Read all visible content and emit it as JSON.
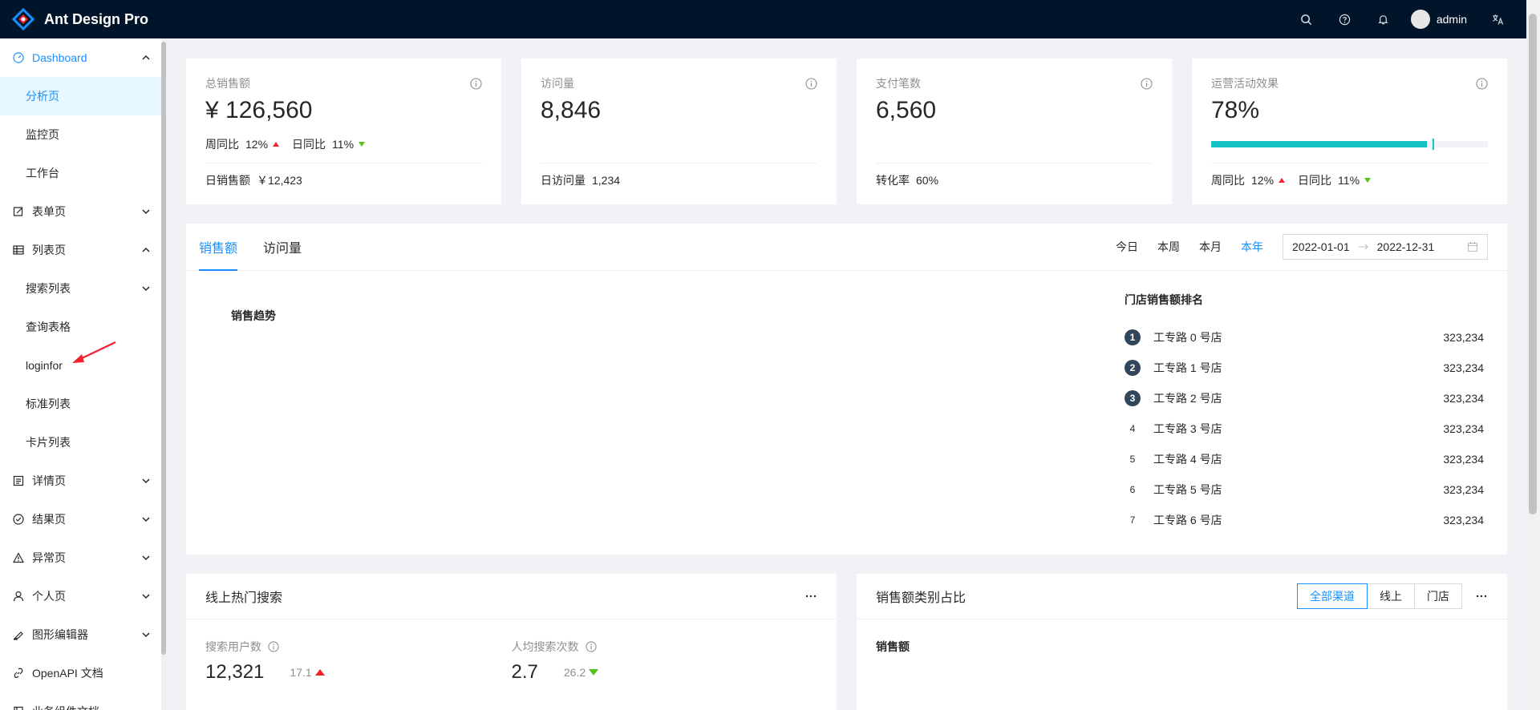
{
  "app": {
    "title": "Ant Design Pro"
  },
  "header": {
    "username": "admin"
  },
  "sidebar": {
    "items": [
      {
        "label": "Dashboard",
        "icon": "dashboard-icon",
        "expanded": true
      },
      {
        "label": "分析页",
        "sub": true,
        "active": true
      },
      {
        "label": "监控页",
        "sub": true
      },
      {
        "label": "工作台",
        "sub": true
      },
      {
        "label": "表单页",
        "icon": "form-icon",
        "expanded": false
      },
      {
        "label": "列表页",
        "icon": "table-icon",
        "expanded": true
      },
      {
        "label": "搜索列表",
        "sub": true,
        "expanded": false
      },
      {
        "label": "查询表格",
        "sub": true
      },
      {
        "label": "loginfor",
        "sub": true
      },
      {
        "label": "标准列表",
        "sub": true
      },
      {
        "label": "卡片列表",
        "sub": true
      },
      {
        "label": "详情页",
        "icon": "profile-icon",
        "expanded": false
      },
      {
        "label": "结果页",
        "icon": "check-circle-icon",
        "expanded": false
      },
      {
        "label": "异常页",
        "icon": "warning-icon",
        "expanded": false
      },
      {
        "label": "个人页",
        "icon": "user-icon",
        "expanded": false
      },
      {
        "label": "图形编辑器",
        "icon": "highlight-icon",
        "expanded": false
      },
      {
        "label": "OpenAPI 文档",
        "icon": "link-icon"
      },
      {
        "label": "业务组件文档",
        "icon": "book-icon"
      }
    ]
  },
  "stats": [
    {
      "title": "总销售额",
      "value": "¥ 126,560",
      "trend_wow_label": "周同比",
      "trend_wow": "12%",
      "trend_dod_label": "日同比",
      "trend_dod": "11%",
      "footer_label": "日销售额",
      "footer_value": "￥12,423"
    },
    {
      "title": "访问量",
      "value": "8,846",
      "footer_label": "日访问量",
      "footer_value": "1,234"
    },
    {
      "title": "支付笔数",
      "value": "6,560",
      "footer_label": "转化率",
      "footer_value": "60%"
    },
    {
      "title": "运营活动效果",
      "value": "78%",
      "progress": 0.78,
      "target": 0.8,
      "trend_wow_label": "周同比",
      "trend_wow": "12%",
      "trend_dod_label": "日同比",
      "trend_dod": "11%"
    }
  ],
  "sales": {
    "tabs": [
      "销售额",
      "访问量"
    ],
    "ranges": [
      "今日",
      "本周",
      "本月",
      "本年"
    ],
    "date_start": "2022-01-01",
    "date_end": "2022-12-31",
    "chart_title": "销售趋势",
    "rank_title": "门店销售额排名",
    "ranking": [
      {
        "rank": "1",
        "name": "工专路 0 号店",
        "value": "323,234"
      },
      {
        "rank": "2",
        "name": "工专路 1 号店",
        "value": "323,234"
      },
      {
        "rank": "3",
        "name": "工专路 2 号店",
        "value": "323,234"
      },
      {
        "rank": "4",
        "name": "工专路 3 号店",
        "value": "323,234"
      },
      {
        "rank": "5",
        "name": "工专路 4 号店",
        "value": "323,234"
      },
      {
        "rank": "6",
        "name": "工专路 5 号店",
        "value": "323,234"
      },
      {
        "rank": "7",
        "name": "工专路 6 号店",
        "value": "323,234"
      }
    ]
  },
  "hot_search": {
    "title": "线上热门搜索",
    "users_label": "搜索用户数",
    "users_value": "12,321",
    "users_sub": "17.1",
    "per_label": "人均搜索次数",
    "per_value": "2.7",
    "per_sub": "26.2"
  },
  "category": {
    "title": "销售额类别占比",
    "segments": [
      "全部渠道",
      "线上",
      "门店"
    ],
    "label": "销售额"
  },
  "colors": {
    "accent": "#1890ff",
    "header_bg": "#001529",
    "progress": "#13c2c2",
    "up": "#f5222d",
    "down": "#52c41a"
  }
}
